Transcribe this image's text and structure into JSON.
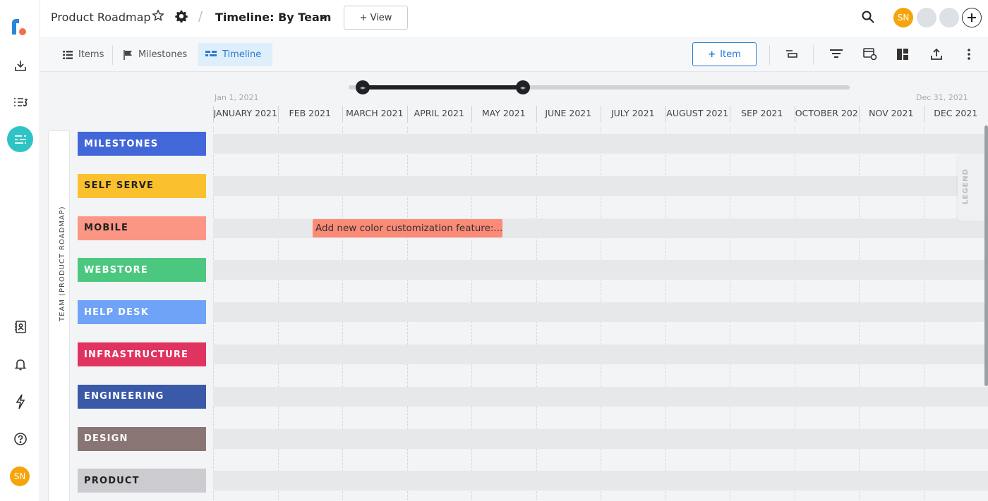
{
  "rail": {
    "icons": [
      "roadmunk-logo-icon",
      "import-icon",
      "list-icon",
      "timeline-icon",
      "contacts-icon",
      "bell-icon",
      "bolt-icon",
      "help-icon"
    ],
    "avatar": "SN",
    "active_color": "#2ec4c6"
  },
  "topbar": {
    "project": "Product Roadmap",
    "view_name": "Timeline: By Team",
    "add_view": "+ View",
    "user_initials": "SN"
  },
  "tabs": {
    "items": "Items",
    "milestones": "Milestones",
    "timeline": "Timeline",
    "add_item": "Item"
  },
  "timeline": {
    "start_date": "Jan 1, 2021",
    "end_date": "Dec 31, 2021",
    "months": [
      "JANUARY 2021",
      "FEB 2021",
      "MARCH 2021",
      "APRIL 2021",
      "MAY 2021",
      "JUNE 2021",
      "JULY 2021",
      "AUGUST 2021",
      "SEP 2021",
      "OCTOBER 202",
      "NOV 2021",
      "DEC 2021"
    ],
    "axis_label": "TEAM (PRODUCT ROADMAP)",
    "legend": "LEGEND",
    "teams": [
      {
        "name": "MILESTONES",
        "color": "#4267d8",
        "text": "#fff"
      },
      {
        "name": "SELF SERVE",
        "color": "#fbc02d",
        "text": "#222"
      },
      {
        "name": "MOBILE",
        "color": "#fb9584",
        "text": "#222"
      },
      {
        "name": "WEBSTORE",
        "color": "#4cc77f",
        "text": "#fff"
      },
      {
        "name": "HELP DESK",
        "color": "#6fa3f7",
        "text": "#fff"
      },
      {
        "name": "INFRASTRUCTURE",
        "color": "#e0335f",
        "text": "#fff"
      },
      {
        "name": "ENGINEERING",
        "color": "#3a59a8",
        "text": "#fff"
      },
      {
        "name": "DESIGN",
        "color": "#8a7575",
        "text": "#fff"
      },
      {
        "name": "PRODUCT",
        "color": "#cbcbd0",
        "text": "#222"
      }
    ],
    "items": [
      {
        "label": "Add new color customization feature:...",
        "team": "MOBILE",
        "color": "#fb8a76"
      }
    ]
  }
}
